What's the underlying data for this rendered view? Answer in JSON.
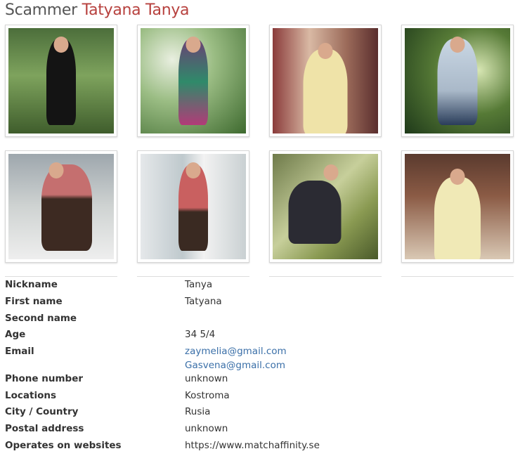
{
  "page": {
    "title_prefix": "Scammer",
    "title_name": "Tatyana Tanya"
  },
  "photos": [
    {
      "label": "photo-1"
    },
    {
      "label": "photo-2"
    },
    {
      "label": "photo-3"
    },
    {
      "label": "photo-4"
    },
    {
      "label": "photo-5"
    },
    {
      "label": "photo-6"
    },
    {
      "label": "photo-7"
    },
    {
      "label": "photo-8"
    }
  ],
  "profile": {
    "nickname": {
      "label": "Nickname",
      "value": "Tanya"
    },
    "first_name": {
      "label": "First name",
      "value": "Tatyana"
    },
    "second_name": {
      "label": "Second name",
      "value": ""
    },
    "age": {
      "label": "Age",
      "value": "34 5/4"
    },
    "email": {
      "label": "Email",
      "value": "zaymelia@gmail.com",
      "value2": "Gasvena@gmail.com"
    },
    "phone": {
      "label": "Phone number",
      "value": "unknown"
    },
    "locations": {
      "label": "Locations",
      "value": "Kostroma"
    },
    "city_country": {
      "label": "City / Country",
      "value": "Rusia"
    },
    "postal_address": {
      "label": "Postal address",
      "value": "unknown"
    },
    "websites": {
      "label": "Operates on websites",
      "value": "https://www.matchaffinity.se"
    }
  }
}
